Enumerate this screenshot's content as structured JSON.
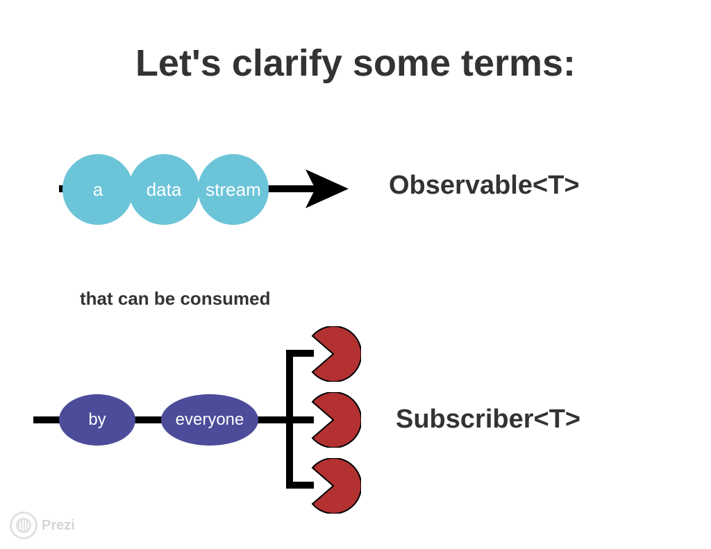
{
  "title": "Let's clarify some terms:",
  "observable": {
    "bubbles": [
      "a",
      "data",
      "stream"
    ],
    "label": "Observable<T>",
    "bubble_color": "#6cc4d8"
  },
  "connector_text": "that can be consumed",
  "subscriber": {
    "bubbles": [
      "by",
      "everyone"
    ],
    "label": "Subscriber<T>",
    "bubble_color": "#4c4c9a",
    "pacman_color": "#b33131",
    "pacman_count": 3
  },
  "watermark": "Prezi"
}
